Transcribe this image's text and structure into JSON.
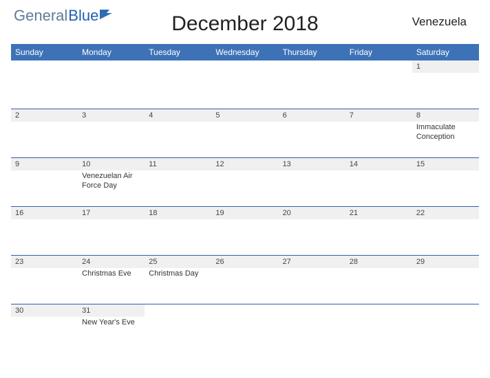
{
  "brand": {
    "part1": "General",
    "part2": "Blue"
  },
  "title": "December 2018",
  "country": "Venezuela",
  "day_names": [
    "Sunday",
    "Monday",
    "Tuesday",
    "Wednesday",
    "Thursday",
    "Friday",
    "Saturday"
  ],
  "weeks": [
    [
      {
        "n": "",
        "e": ""
      },
      {
        "n": "",
        "e": ""
      },
      {
        "n": "",
        "e": ""
      },
      {
        "n": "",
        "e": ""
      },
      {
        "n": "",
        "e": ""
      },
      {
        "n": "",
        "e": ""
      },
      {
        "n": "1",
        "e": ""
      }
    ],
    [
      {
        "n": "2",
        "e": ""
      },
      {
        "n": "3",
        "e": ""
      },
      {
        "n": "4",
        "e": ""
      },
      {
        "n": "5",
        "e": ""
      },
      {
        "n": "6",
        "e": ""
      },
      {
        "n": "7",
        "e": ""
      },
      {
        "n": "8",
        "e": "Immaculate Conception"
      }
    ],
    [
      {
        "n": "9",
        "e": ""
      },
      {
        "n": "10",
        "e": "Venezuelan Air Force Day"
      },
      {
        "n": "11",
        "e": ""
      },
      {
        "n": "12",
        "e": ""
      },
      {
        "n": "13",
        "e": ""
      },
      {
        "n": "14",
        "e": ""
      },
      {
        "n": "15",
        "e": ""
      }
    ],
    [
      {
        "n": "16",
        "e": ""
      },
      {
        "n": "17",
        "e": ""
      },
      {
        "n": "18",
        "e": ""
      },
      {
        "n": "19",
        "e": ""
      },
      {
        "n": "20",
        "e": ""
      },
      {
        "n": "21",
        "e": ""
      },
      {
        "n": "22",
        "e": ""
      }
    ],
    [
      {
        "n": "23",
        "e": ""
      },
      {
        "n": "24",
        "e": "Christmas Eve"
      },
      {
        "n": "25",
        "e": "Christmas Day"
      },
      {
        "n": "26",
        "e": ""
      },
      {
        "n": "27",
        "e": ""
      },
      {
        "n": "28",
        "e": ""
      },
      {
        "n": "29",
        "e": ""
      }
    ],
    [
      {
        "n": "30",
        "e": ""
      },
      {
        "n": "31",
        "e": "New Year's Eve"
      },
      {
        "n": "",
        "e": ""
      },
      {
        "n": "",
        "e": ""
      },
      {
        "n": "",
        "e": ""
      },
      {
        "n": "",
        "e": ""
      },
      {
        "n": "",
        "e": ""
      }
    ]
  ]
}
